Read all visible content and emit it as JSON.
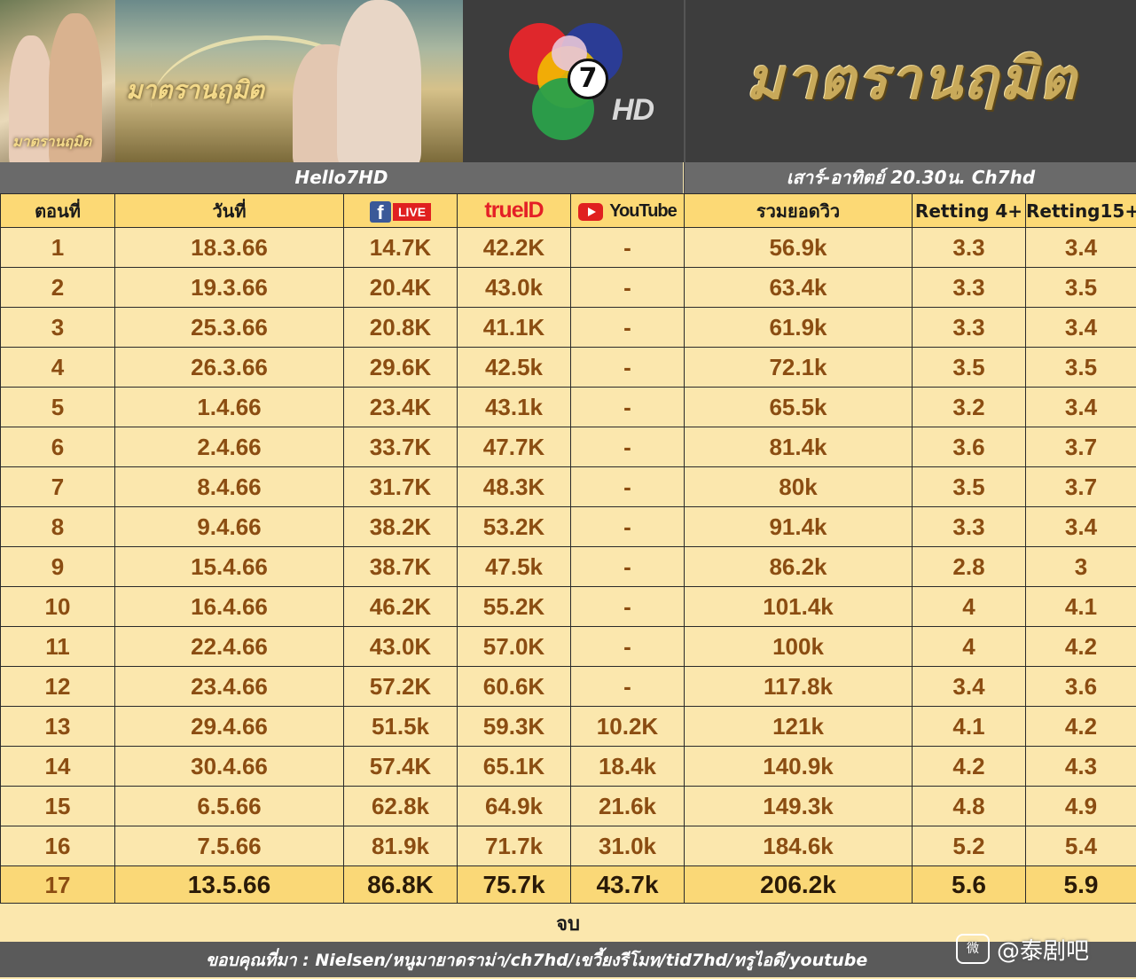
{
  "header": {
    "poster_title": "มาตรานฤมิต",
    "channel_number": "7",
    "channel_hd": "HD",
    "show_title": "มาตรานฤมิต"
  },
  "subheader": {
    "left": "Hello7HD",
    "right": "เสาร์-อาทิตย์ 20.30น. Ch7hd"
  },
  "table": {
    "columns": {
      "episode": "ตอนที่",
      "date": "วันที่",
      "facebook_f": "f",
      "facebook_live": "LIVE",
      "trueid": "trueID",
      "youtube": "YouTube",
      "total_views": "รวมยอดวิว",
      "rating4": "Retting 4+",
      "rating15": "Retting15+"
    },
    "rows": [
      {
        "ep": "1",
        "date": "18.3.66",
        "fb": "14.7K",
        "trueid": "42.2K",
        "yt": "-",
        "total": "56.9k",
        "r4": "3.3",
        "r15": "3.4"
      },
      {
        "ep": "2",
        "date": "19.3.66",
        "fb": "20.4K",
        "trueid": "43.0k",
        "yt": "-",
        "total": "63.4k",
        "r4": "3.3",
        "r15": "3.5"
      },
      {
        "ep": "3",
        "date": "25.3.66",
        "fb": "20.8K",
        "trueid": "41.1K",
        "yt": "-",
        "total": "61.9k",
        "r4": "3.3",
        "r15": "3.4"
      },
      {
        "ep": "4",
        "date": "26.3.66",
        "fb": "29.6K",
        "trueid": "42.5k",
        "yt": "-",
        "total": "72.1k",
        "r4": "3.5",
        "r15": "3.5"
      },
      {
        "ep": "5",
        "date": "1.4.66",
        "fb": "23.4K",
        "trueid": "43.1k",
        "yt": "-",
        "total": "65.5k",
        "r4": "3.2",
        "r15": "3.4"
      },
      {
        "ep": "6",
        "date": "2.4.66",
        "fb": "33.7K",
        "trueid": "47.7K",
        "yt": "-",
        "total": "81.4k",
        "r4": "3.6",
        "r15": "3.7"
      },
      {
        "ep": "7",
        "date": "8.4.66",
        "fb": "31.7K",
        "trueid": "48.3K",
        "yt": "-",
        "total": "80k",
        "r4": "3.5",
        "r15": "3.7"
      },
      {
        "ep": "8",
        "date": "9.4.66",
        "fb": "38.2K",
        "trueid": "53.2K",
        "yt": "-",
        "total": "91.4k",
        "r4": "3.3",
        "r15": "3.4"
      },
      {
        "ep": "9",
        "date": "15.4.66",
        "fb": "38.7K",
        "trueid": "47.5k",
        "yt": "-",
        "total": "86.2k",
        "r4": "2.8",
        "r15": "3"
      },
      {
        "ep": "10",
        "date": "16.4.66",
        "fb": "46.2K",
        "trueid": "55.2K",
        "yt": "-",
        "total": "101.4k",
        "r4": "4",
        "r15": "4.1"
      },
      {
        "ep": "11",
        "date": "22.4.66",
        "fb": "43.0K",
        "trueid": "57.0K",
        "yt": "-",
        "total": "100k",
        "r4": "4",
        "r15": "4.2"
      },
      {
        "ep": "12",
        "date": "23.4.66",
        "fb": "57.2K",
        "trueid": "60.6K",
        "yt": "-",
        "total": "117.8k",
        "r4": "3.4",
        "r15": "3.6"
      },
      {
        "ep": "13",
        "date": "29.4.66",
        "fb": "51.5k",
        "trueid": "59.3K",
        "yt": "10.2K",
        "total": "121k",
        "r4": "4.1",
        "r15": "4.2"
      },
      {
        "ep": "14",
        "date": "30.4.66",
        "fb": "57.4K",
        "trueid": "65.1K",
        "yt": "18.4k",
        "total": "140.9k",
        "r4": "4.2",
        "r15": "4.3"
      },
      {
        "ep": "15",
        "date": "6.5.66",
        "fb": "62.8k",
        "trueid": "64.9k",
        "yt": "21.6k",
        "total": "149.3k",
        "r4": "4.8",
        "r15": "4.9"
      },
      {
        "ep": "16",
        "date": "7.5.66",
        "fb": "81.9k",
        "trueid": "71.7k",
        "yt": "31.0k",
        "total": "184.6k",
        "r4": "5.2",
        "r15": "5.4"
      },
      {
        "ep": "17",
        "date": "13.5.66",
        "fb": "86.8K",
        "trueid": "75.7k",
        "yt": "43.7k",
        "total": "206.2k",
        "r4": "5.6",
        "r15": "5.9"
      }
    ]
  },
  "end_label": "จบ",
  "footer": {
    "credits": "ขอบคุณที่มา : Nielsen/หนูมายาดราม่า/ch7hd/เขวี้ยงรีโมท/tid7hd/ทรูไอดี/youtube",
    "watermark_icon": "微",
    "watermark_text": "@泰剧吧"
  },
  "colors": {
    "table_bg": "#fbe7ad",
    "header_bg": "#fcd975",
    "value_text": "#8b4d12",
    "subheader_bg": "#6a6a6a",
    "final_row_bg": "#fad877"
  }
}
